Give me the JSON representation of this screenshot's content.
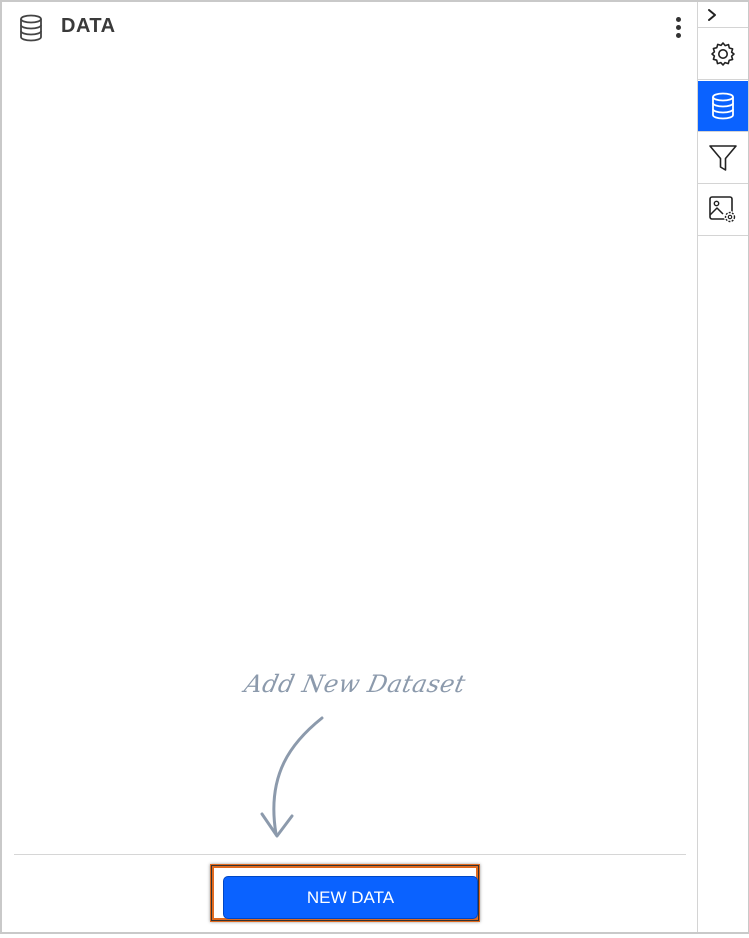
{
  "panel": {
    "title": "DATA",
    "header_icon": "database-icon",
    "menu_icon": "more-vertical-icon"
  },
  "hint": {
    "text": "Add New Dataset",
    "arrow_icon": "curved-arrow-down-icon"
  },
  "actions": {
    "new_data_label": "NEW DATA"
  },
  "toolbar": {
    "toggle_icon": "chevron-right-icon",
    "items": [
      {
        "icon": "gear-icon",
        "active": false
      },
      {
        "icon": "database-icon",
        "active": true
      },
      {
        "icon": "filter-icon",
        "active": false
      },
      {
        "icon": "image-settings-icon",
        "active": false
      }
    ]
  },
  "colors": {
    "accent": "#0a62ff",
    "highlight_border": "#e06a1f",
    "hint_text": "#8c9aac",
    "title_text": "#3a3a3a"
  }
}
